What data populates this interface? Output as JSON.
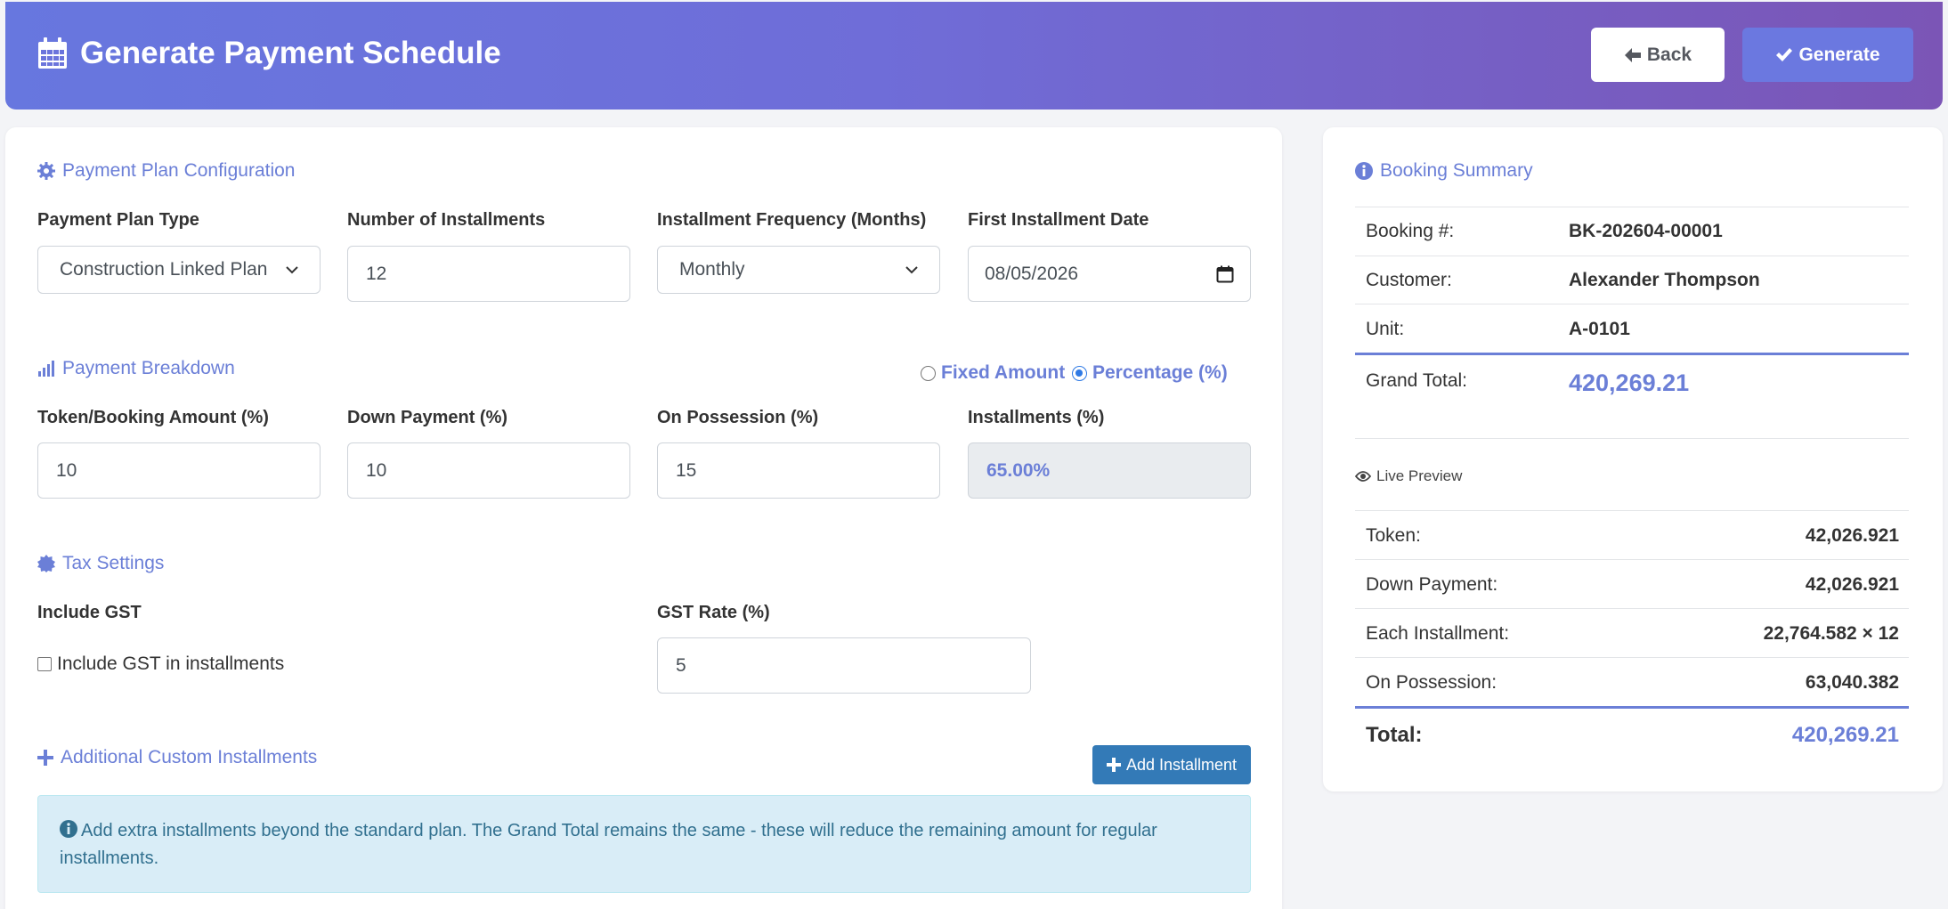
{
  "header": {
    "title": "Generate Payment Schedule",
    "back_label": "Back",
    "generate_label": "Generate"
  },
  "config": {
    "section_title": "Payment Plan Configuration",
    "plan_type_label": "Payment Plan Type",
    "plan_type_value": "Construction Linked Plan",
    "num_installments_label": "Number of Installments",
    "num_installments_value": "12",
    "frequency_label": "Installment Frequency (Months)",
    "frequency_value": "Monthly",
    "first_date_label": "First Installment Date",
    "first_date_value": "08/05/2026"
  },
  "breakdown": {
    "section_title": "Payment Breakdown",
    "fixed_amount_label": "Fixed Amount",
    "percentage_label": "Percentage (%)",
    "selected_mode": "percentage",
    "token_label": "Token/Booking Amount (%)",
    "token_value": "10",
    "down_payment_label": "Down Payment (%)",
    "down_payment_value": "10",
    "possession_label": "On Possession (%)",
    "possession_value": "15",
    "installments_label": "Installments (%)",
    "installments_value": "65.00%"
  },
  "tax": {
    "section_title": "Tax Settings",
    "include_gst_label": "Include GST",
    "include_gst_checkbox_label": "Include GST in installments",
    "include_gst_checked": false,
    "gst_rate_label": "GST Rate (%)",
    "gst_rate_value": "5"
  },
  "custom": {
    "section_title": "Additional Custom Installments",
    "add_button_label": "Add Installment",
    "info_text": "Add extra installments beyond the standard plan. The Grand Total remains the same - these will reduce the remaining amount for regular installments."
  },
  "summary": {
    "title": "Booking Summary",
    "booking_label": "Booking #:",
    "booking_value": "BK-202604-00001",
    "customer_label": "Customer:",
    "customer_value": "Alexander Thompson",
    "unit_label": "Unit:",
    "unit_value": "A-0101",
    "grand_total_label": "Grand Total:",
    "grand_total_value": "420,269.21"
  },
  "preview": {
    "title": "Live Preview",
    "token_label": "Token:",
    "token_value": "42,026.921",
    "down_payment_label": "Down Payment:",
    "down_payment_value": "42,026.921",
    "each_installment_label": "Each Installment:",
    "each_installment_value": "22,764.582 × 12",
    "possession_label": "On Possession:",
    "possession_value": "63,040.382",
    "total_label": "Total:",
    "total_value": "420,269.21"
  },
  "colors": {
    "accent": "#6b7fd7",
    "header_start": "#6777df",
    "header_end": "#7b55b6",
    "add_button": "#337ab7",
    "info_bg": "#d9edf7"
  }
}
